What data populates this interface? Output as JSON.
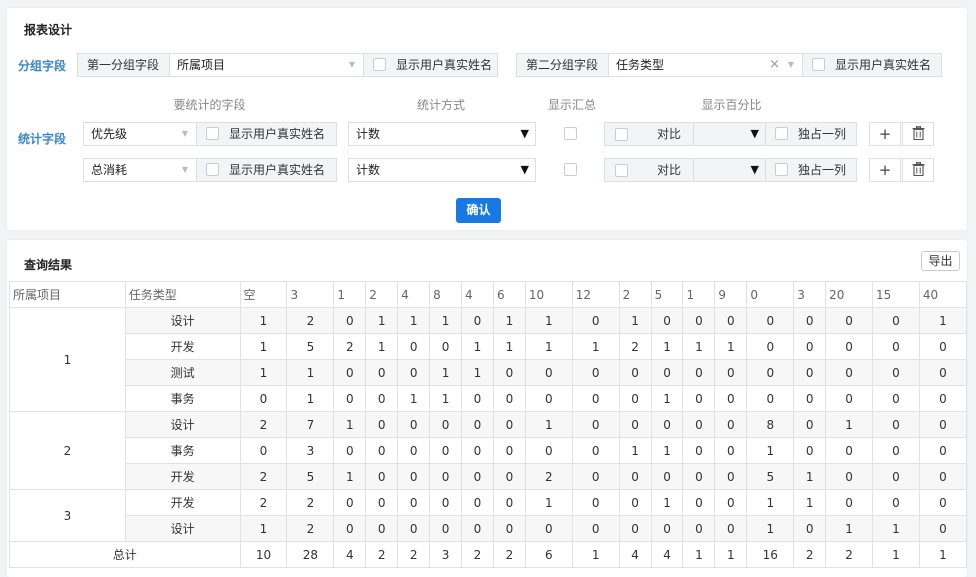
{
  "design": {
    "title": "报表设计",
    "group_label": "分组字段",
    "stat_label": "统计字段",
    "group1": {
      "label": "第一分组字段",
      "value": "所属项目",
      "real_name": "显示用户真实姓名"
    },
    "group2": {
      "label": "第二分组字段",
      "value": "任务类型",
      "real_name": "显示用户真实姓名"
    },
    "columns": {
      "field": "要统计的字段",
      "method": "统计方式",
      "summary": "显示汇总",
      "percent": "显示百分比"
    },
    "stat_rows": [
      {
        "field": "优先级",
        "real_name": "显示用户真实姓名",
        "method": "计数",
        "compare": "对比",
        "exclusive": "独占一列"
      },
      {
        "field": "总消耗",
        "real_name": "显示用户真实姓名",
        "method": "计数",
        "compare": "对比",
        "exclusive": "独占一列"
      }
    ],
    "confirm_label": "确认"
  },
  "result": {
    "title": "查询结果",
    "export_label": "导出",
    "headers": [
      "所属项目",
      "任务类型",
      "空",
      "3",
      "1",
      "2",
      "4",
      "8",
      "4",
      "6",
      "10",
      "12",
      "2",
      "5",
      "1",
      "9",
      "0",
      "3",
      "20",
      "15",
      "40"
    ],
    "groups": [
      {
        "name": "1",
        "rows": [
          {
            "type": "设计",
            "values": [
              "1",
              "2",
              "0",
              "1",
              "1",
              "1",
              "0",
              "1",
              "1",
              "0",
              "1",
              "0",
              "0",
              "0",
              "0",
              "0",
              "0",
              "0",
              "1"
            ]
          },
          {
            "type": "开发",
            "values": [
              "1",
              "5",
              "2",
              "1",
              "0",
              "0",
              "1",
              "1",
              "1",
              "1",
              "2",
              "1",
              "1",
              "1",
              "0",
              "0",
              "0",
              "0",
              "0"
            ]
          },
          {
            "type": "测试",
            "values": [
              "1",
              "1",
              "0",
              "0",
              "0",
              "1",
              "1",
              "0",
              "0",
              "0",
              "0",
              "0",
              "0",
              "0",
              "0",
              "0",
              "0",
              "0",
              "0"
            ]
          },
          {
            "type": "事务",
            "values": [
              "0",
              "1",
              "0",
              "0",
              "1",
              "1",
              "0",
              "0",
              "0",
              "0",
              "0",
              "1",
              "0",
              "0",
              "0",
              "0",
              "0",
              "0",
              "0"
            ]
          }
        ]
      },
      {
        "name": "2",
        "rows": [
          {
            "type": "设计",
            "values": [
              "2",
              "7",
              "1",
              "0",
              "0",
              "0",
              "0",
              "0",
              "1",
              "0",
              "0",
              "0",
              "0",
              "0",
              "8",
              "0",
              "1",
              "0",
              "0"
            ]
          },
          {
            "type": "事务",
            "values": [
              "0",
              "3",
              "0",
              "0",
              "0",
              "0",
              "0",
              "0",
              "0",
              "0",
              "1",
              "1",
              "0",
              "0",
              "1",
              "0",
              "0",
              "0",
              "0"
            ]
          },
          {
            "type": "开发",
            "values": [
              "2",
              "5",
              "1",
              "0",
              "0",
              "0",
              "0",
              "0",
              "2",
              "0",
              "0",
              "0",
              "0",
              "0",
              "5",
              "1",
              "0",
              "0",
              "0"
            ]
          }
        ]
      },
      {
        "name": "3",
        "rows": [
          {
            "type": "开发",
            "values": [
              "2",
              "2",
              "0",
              "0",
              "0",
              "0",
              "0",
              "0",
              "1",
              "0",
              "0",
              "1",
              "0",
              "0",
              "1",
              "1",
              "0",
              "0",
              "0"
            ]
          },
          {
            "type": "设计",
            "values": [
              "1",
              "2",
              "0",
              "0",
              "0",
              "0",
              "0",
              "0",
              "0",
              "0",
              "0",
              "0",
              "0",
              "0",
              "1",
              "0",
              "1",
              "1",
              "0"
            ]
          }
        ]
      }
    ],
    "total_label": "总计",
    "totals": [
      "10",
      "28",
      "4",
      "2",
      "2",
      "3",
      "2",
      "2",
      "6",
      "1",
      "4",
      "4",
      "1",
      "1",
      "16",
      "2",
      "2",
      "1",
      "1"
    ]
  }
}
